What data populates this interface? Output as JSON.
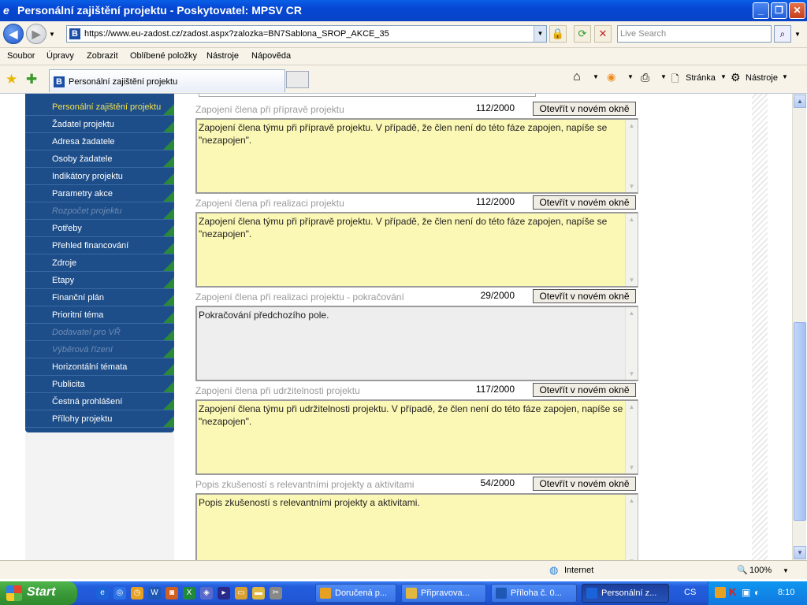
{
  "window": {
    "title": "Personální zajištění projektu - Poskytovatel: MPSV CR"
  },
  "address": {
    "url": "https://www.eu-zadost.cz/zadost.aspx?zalozka=BN7Sablona_SROP_AKCE_35",
    "search_placeholder": "Live Search"
  },
  "menu": [
    "Soubor",
    "Úpravy",
    "Zobrazit",
    "Oblíbené položky",
    "Nástroje",
    "Nápověda"
  ],
  "tab": {
    "label": "Personální zajištění projektu",
    "favicon": "B"
  },
  "tab_tools": {
    "page": "Stránka",
    "tools": "Nástroje"
  },
  "sidebar": {
    "items": [
      {
        "label": "Personální zajištění projektu",
        "state": "active"
      },
      {
        "label": "Žadatel projektu",
        "state": "normal"
      },
      {
        "label": "Adresa žadatele",
        "state": "normal"
      },
      {
        "label": "Osoby žadatele",
        "state": "normal"
      },
      {
        "label": "Indikátory projektu",
        "state": "normal"
      },
      {
        "label": "Parametry akce",
        "state": "normal"
      },
      {
        "label": "Rozpočet projektu",
        "state": "disabled"
      },
      {
        "label": "Potřeby",
        "state": "normal"
      },
      {
        "label": "Přehled financování",
        "state": "normal"
      },
      {
        "label": "Zdroje",
        "state": "normal"
      },
      {
        "label": "Etapy",
        "state": "normal"
      },
      {
        "label": "Finanční plán",
        "state": "normal"
      },
      {
        "label": "Prioritní téma",
        "state": "normal"
      },
      {
        "label": "Dodavatel pro VŘ",
        "state": "disabled"
      },
      {
        "label": "Výběrová řízení",
        "state": "disabled"
      },
      {
        "label": "Horizontální témata",
        "state": "normal"
      },
      {
        "label": "Publicita",
        "state": "normal"
      },
      {
        "label": "Čestná prohlášení",
        "state": "normal"
      },
      {
        "label": "Přílohy projektu",
        "state": "normal"
      }
    ]
  },
  "fields": [
    {
      "label": "Zapojení člena při přípravě projektu",
      "count": "112/2000",
      "button": "Otevřít v novém okně",
      "value": "Zapojení člena týmu při přípravě projektu. V případě, že člen není do této fáze zapojen, napíše se \"nezapojen\".",
      "bg": "yellow"
    },
    {
      "label": "Zapojení člena při realizaci projektu",
      "count": "112/2000",
      "button": "Otevřít v novém okně",
      "value": "Zapojení člena týmu při přípravě projektu. V případě, že člen není do této fáze zapojen, napíše se \"nezapojen\".",
      "bg": "yellow"
    },
    {
      "label": "Zapojení člena při realizaci projektu - pokračování",
      "count": "29/2000",
      "button": "Otevřít v novém okně",
      "value": "Pokračování předchozího pole.",
      "bg": "grey"
    },
    {
      "label": "Zapojení člena při udržitelnosti projektu",
      "count": "117/2000",
      "button": "Otevřít v novém okně",
      "value": "Zapojení člena týmu při udržitelnosti projektu. V případě, že člen není do této fáze zapojen, napíše se \"nezapojen\".",
      "bg": "yellow"
    },
    {
      "label": "Popis zkušeností s relevantními projekty a aktivitami",
      "count": "54/2000",
      "button": "Otevřít v novém okně",
      "value": "Popis zkušeností s relevantními projekty a aktivitami.",
      "bg": "yellow"
    }
  ],
  "status": {
    "zone": "Internet",
    "zoom": "100%"
  },
  "taskbar": {
    "start": "Start",
    "tasks": [
      {
        "label": "Doručená p...",
        "active": false
      },
      {
        "label": "Připravova...",
        "active": false
      },
      {
        "label": "Příloha č. 0...",
        "active": false
      },
      {
        "label": "Personální z...",
        "active": true
      }
    ],
    "lang": "CS",
    "clock": "8:10"
  },
  "colors": {
    "sidebar": "#1d4e8a",
    "active_item": "#f4e04b",
    "textarea_yellow": "#fbf7b4",
    "textarea_grey": "#eeeeee"
  }
}
